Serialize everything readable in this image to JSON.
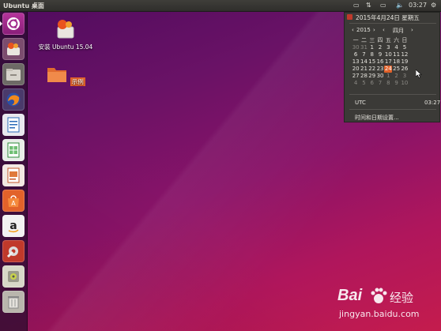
{
  "topbar": {
    "title": "Ubuntu 桌面",
    "time": "03:27"
  },
  "launcher": {
    "items": [
      {
        "name": "dash-home",
        "icon": "ubuntu-logo-icon"
      },
      {
        "name": "install-ubuntu",
        "icon": "installer-icon"
      },
      {
        "name": "files",
        "icon": "files-icon"
      },
      {
        "name": "firefox",
        "icon": "firefox-icon"
      },
      {
        "name": "libreoffice-writer",
        "icon": "writer-icon"
      },
      {
        "name": "libreoffice-calc",
        "icon": "calc-icon"
      },
      {
        "name": "libreoffice-impress",
        "icon": "impress-icon"
      },
      {
        "name": "ubuntu-software",
        "icon": "software-center-icon"
      },
      {
        "name": "amazon",
        "icon": "amazon-icon"
      },
      {
        "name": "system-settings",
        "icon": "settings-icon"
      },
      {
        "name": "disk",
        "icon": "disk-icon"
      },
      {
        "name": "trash",
        "icon": "trash-icon"
      }
    ]
  },
  "desktop": {
    "install_label": "安装 Ubuntu 15.04",
    "examples_label": "示例"
  },
  "calendar": {
    "header": "2015年4月24日 星期五",
    "year": "2015",
    "month": "四月",
    "weekdays": [
      "一",
      "二",
      "三",
      "四",
      "五",
      "六",
      "日"
    ],
    "weeks": [
      [
        "30",
        "31",
        "1",
        "2",
        "3",
        "4",
        "5"
      ],
      [
        "6",
        "7",
        "8",
        "9",
        "10",
        "11",
        "12"
      ],
      [
        "13",
        "14",
        "15",
        "16",
        "17",
        "18",
        "19"
      ],
      [
        "20",
        "21",
        "22",
        "23",
        "24",
        "25",
        "26"
      ],
      [
        "27",
        "28",
        "29",
        "30",
        "1",
        "2",
        "3"
      ],
      [
        "4",
        "5",
        "6",
        "7",
        "8",
        "9",
        "10"
      ]
    ],
    "timezone": "UTC",
    "tz_time": "03:27",
    "settings_link": "时间和日期设置..."
  },
  "watermark": {
    "brand": "Bai",
    "brand_suffix": "经验",
    "url": "jingyan.baidu.com"
  }
}
